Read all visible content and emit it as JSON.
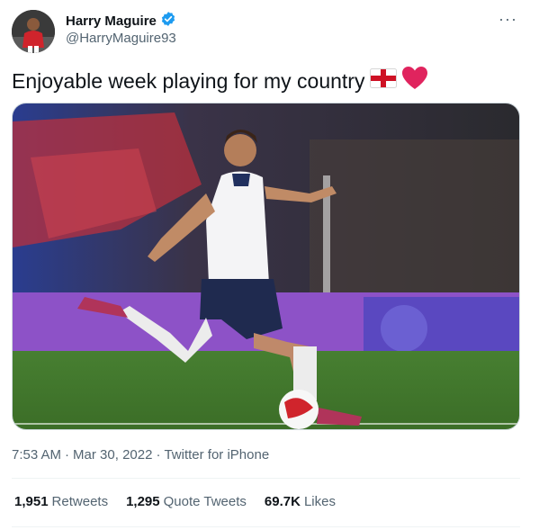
{
  "author": {
    "name": "Harry Maguire",
    "handle": "@HarryMaguire93",
    "verified": true
  },
  "tweet": {
    "text": "Enjoyable week playing for my country",
    "emojis": [
      "england-flag-icon",
      "red-heart-icon"
    ]
  },
  "meta": {
    "time": "7:53 AM",
    "separator": "·",
    "date": "Mar 30, 2022",
    "source": "Twitter for iPhone"
  },
  "stats": {
    "retweets": {
      "count": "1,951",
      "label": "Retweets"
    },
    "quotes": {
      "count": "1,295",
      "label": "Quote Tweets"
    },
    "likes": {
      "count": "69.7K",
      "label": "Likes"
    }
  },
  "menu": {
    "label": "···"
  },
  "colors": {
    "verified": "#1d9bf0",
    "secondary_text": "#536471",
    "heart": "#e0245e",
    "pitch": "#3f7a2c"
  }
}
